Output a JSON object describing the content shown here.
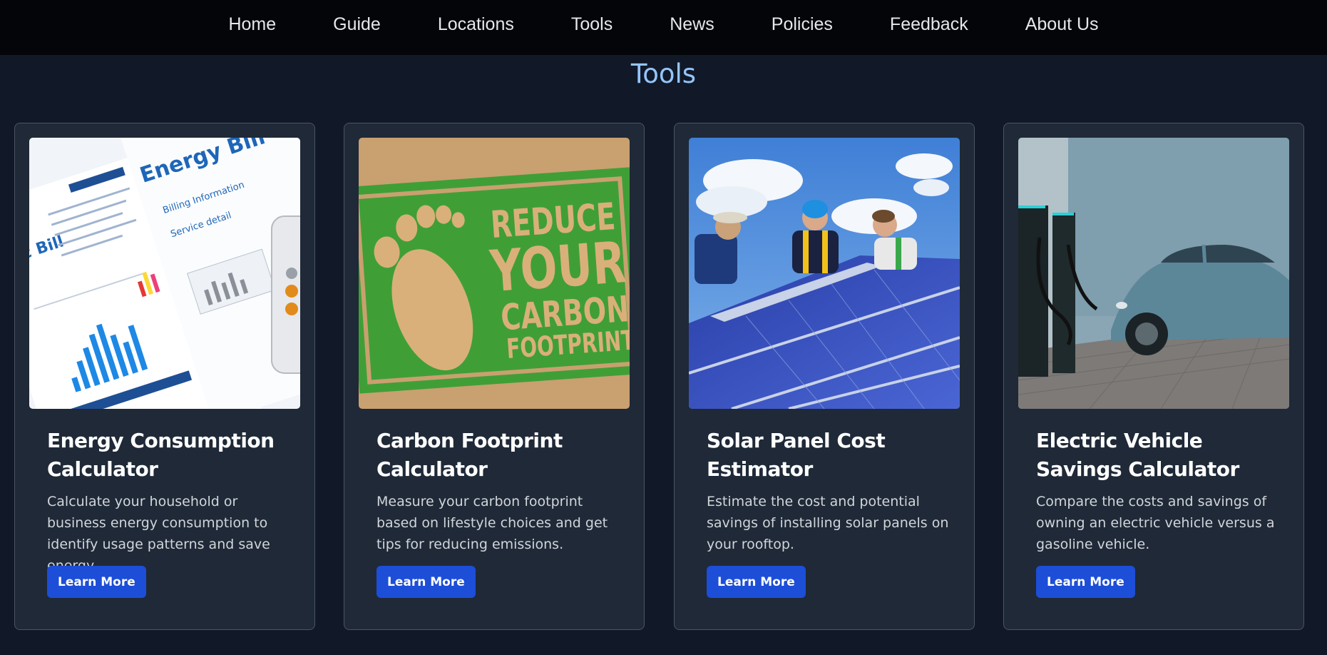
{
  "nav": {
    "items": [
      "Home",
      "Guide",
      "Locations",
      "Tools",
      "News",
      "Policies",
      "Feedback",
      "About Us"
    ]
  },
  "page": {
    "title": "Tools"
  },
  "cards": [
    {
      "title": "Energy Consumption Calculator",
      "description": "Calculate your household or business energy consumption to identify usage patterns and save energy.",
      "button": "Learn More",
      "image": {
        "bill_title": "Energy Bill",
        "bill_line1": "Billing Information",
        "bill_line2": "Service detail",
        "bill_partial": "ric Bill"
      }
    },
    {
      "title": "Carbon Footprint Calculator",
      "description": "Measure your carbon footprint based on lifestyle choices and get tips for reducing emissions.",
      "button": "Learn More",
      "image": {
        "line1": "REDUCE",
        "line2": "YOUR",
        "line3": "CARBON",
        "line4": "FOOTPRINT"
      }
    },
    {
      "title": "Solar Panel Cost Estimator",
      "description": "Estimate the cost and potential savings of installing solar panels on your rooftop.",
      "button": "Learn More"
    },
    {
      "title": "Electric Vehicle Savings Calculator",
      "description": "Compare the costs and savings of owning an electric vehicle versus a gasoline vehicle.",
      "button": "Learn More"
    }
  ],
  "colors": {
    "nav_bg": "#030508",
    "page_bg": "#111827",
    "card_bg": "#1f2937",
    "accent": "#93c5fd",
    "button": "#1d4ed8"
  }
}
